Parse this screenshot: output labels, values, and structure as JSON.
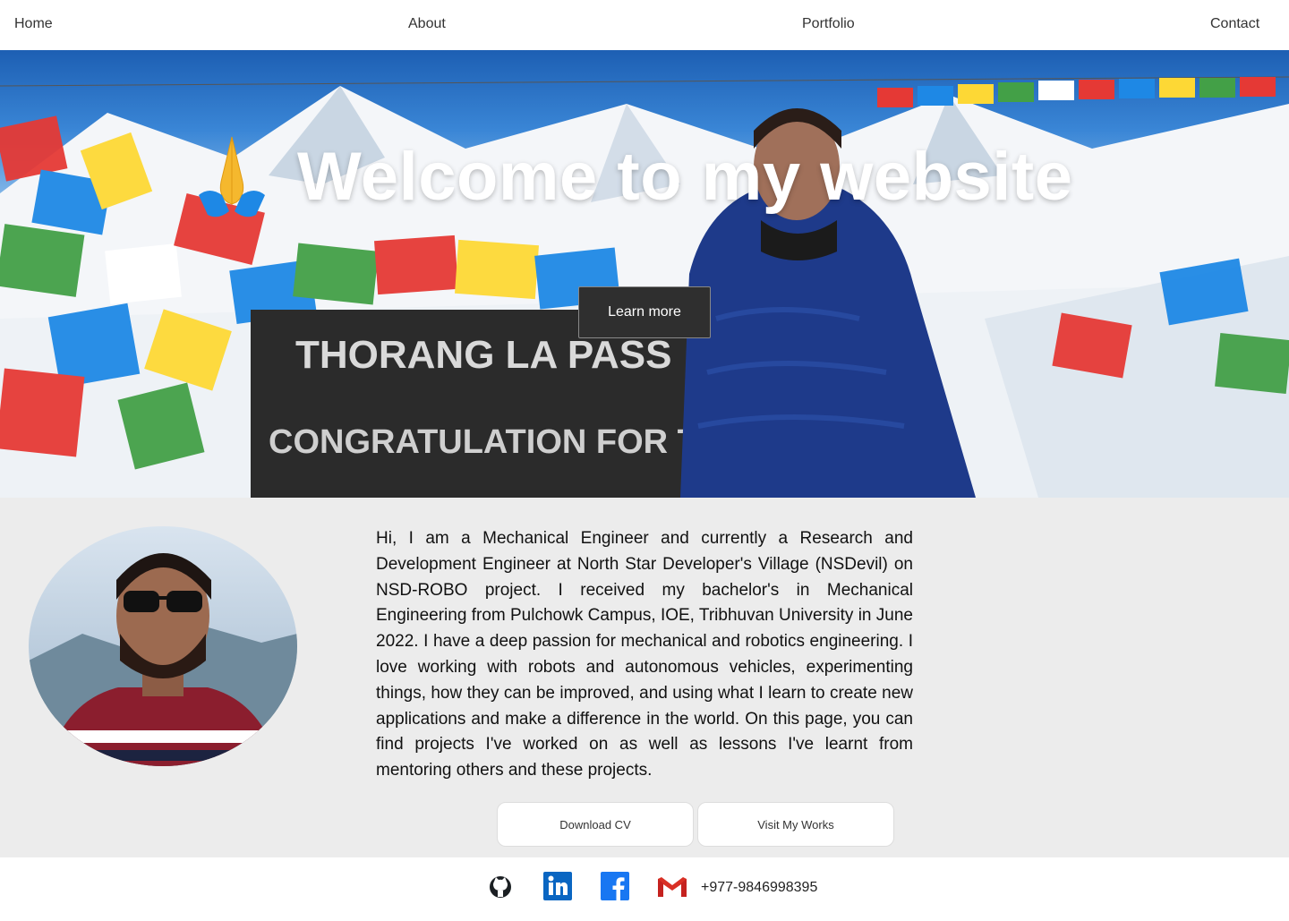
{
  "nav": {
    "items": [
      {
        "label": "Home"
      },
      {
        "label": "About"
      },
      {
        "label": "Portfolio"
      },
      {
        "label": "Contact"
      }
    ]
  },
  "hero": {
    "title": "Welcome to my website",
    "emoji_icon": "folded-hands-icon",
    "cta_label": "Learn more",
    "sign_text": "THORANG LA PASS · CONGRATULATION FOR THE SUCCESS!!"
  },
  "about": {
    "bio": "Hi, I am a Mechanical Engineer and currently a Research and Development Engineer at North Star Developer's Village (NSDevil) on NSD-ROBO project. I received my bachelor's in Mechanical Engineering from Pulchowk Campus, IOE, Tribhuvan University in June 2022. I have a deep passion for mechanical and robotics engineering. I love working with robots and autonomous vehicles, experimenting things, how they can be improved, and using what I learn to create new applications and make a difference in the world. On this page, you can find projects I've worked on as well as lessons I've learnt from mentoring others and these projects.",
    "download_cv_label": "Download CV",
    "visit_works_label": "Visit My Works"
  },
  "footer": {
    "icons": [
      "github-icon",
      "linkedin-icon",
      "facebook-icon",
      "gmail-icon"
    ],
    "phone": "+977-9846998395"
  },
  "colors": {
    "nav_bg": "#ffffff",
    "body_bg": "#ececec",
    "cta_bg": "#2f2f2f",
    "linkedin": "#0a66c2",
    "facebook": "#1877f2"
  }
}
